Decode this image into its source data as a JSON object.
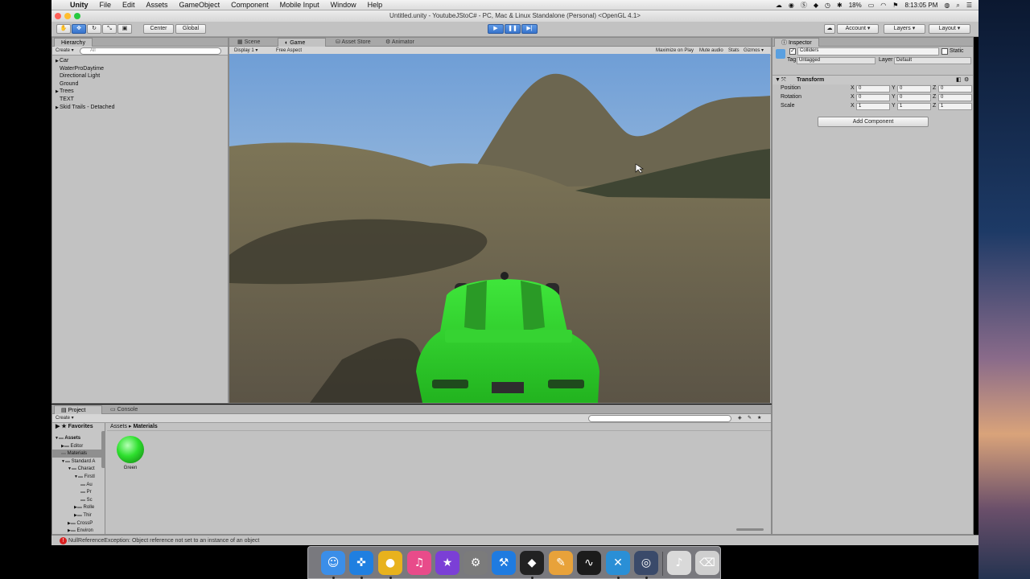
{
  "menubar": {
    "apple": "",
    "items": [
      "Unity",
      "File",
      "Edit",
      "Assets",
      "GameObject",
      "Component",
      "Mobile Input",
      "Window",
      "Help"
    ],
    "battery": "18%",
    "clock": "8:13:05 PM"
  },
  "window": {
    "title": "Untitled.unity - YoutubeJStoC# - PC, Mac & Linux Standalone (Personal) <OpenGL 4.1>"
  },
  "toolbar": {
    "center": "Center",
    "global": "Global",
    "account": "Account",
    "layers": "Layers",
    "layout": "Layout"
  },
  "hierarchy": {
    "tab": "Hierarchy",
    "create": "Create",
    "search_placeholder": "All",
    "items": [
      {
        "label": "Car",
        "expandable": true
      },
      {
        "label": "WaterProDaytime",
        "expandable": false
      },
      {
        "label": "Directional Light",
        "expandable": false
      },
      {
        "label": "Ground",
        "expandable": false
      },
      {
        "label": "Trees",
        "expandable": true
      },
      {
        "label": "TEXT",
        "expandable": false
      },
      {
        "label": "Skid Trails - Detached",
        "expandable": true
      }
    ]
  },
  "view_tabs": {
    "scene": "Scene",
    "game": "Game",
    "asset_store": "Asset Store",
    "animator": "Animator"
  },
  "game_bar": {
    "display": "Display 1",
    "aspect": "Free Aspect",
    "maximize": "Maximize on Play",
    "mute": "Mute audio",
    "stats": "Stats",
    "gizmos": "Gizmos"
  },
  "inspector": {
    "tab": "Inspector",
    "object_name": "Colliders",
    "static": "Static",
    "tag_label": "Tag",
    "tag_value": "Untagged",
    "layer_label": "Layer",
    "layer_value": "Default",
    "transform": "Transform",
    "rows": [
      {
        "label": "Position",
        "x": "0",
        "y": "0",
        "z": "0"
      },
      {
        "label": "Rotation",
        "x": "0",
        "y": "0",
        "z": "0"
      },
      {
        "label": "Scale",
        "x": "1",
        "y": "1",
        "z": "1"
      }
    ],
    "axis": [
      "X",
      "Y",
      "Z"
    ],
    "add_component": "Add Component"
  },
  "project": {
    "tab": "Project",
    "console_tab": "Console",
    "create": "Create",
    "favorites": "Favorites",
    "breadcrumb_root": "Assets",
    "breadcrumb_sep": "▸",
    "breadcrumb_leaf": "Materials",
    "tree": [
      {
        "label": "Assets",
        "level": 0,
        "bold": true,
        "arrow": "▼"
      },
      {
        "label": "Editor",
        "level": 1,
        "bold": false,
        "arrow": "▶"
      },
      {
        "label": "Materials",
        "level": 1,
        "bold": false,
        "arrow": "",
        "selected": true
      },
      {
        "label": "Standard A",
        "level": 1,
        "bold": false,
        "arrow": "▼"
      },
      {
        "label": "Charact",
        "level": 2,
        "bold": false,
        "arrow": "▼"
      },
      {
        "label": "FirstI",
        "level": 3,
        "bold": false,
        "arrow": "▼"
      },
      {
        "label": "Au",
        "level": 4,
        "bold": false,
        "arrow": ""
      },
      {
        "label": "Pr",
        "level": 4,
        "bold": false,
        "arrow": ""
      },
      {
        "label": "Sc",
        "level": 4,
        "bold": false,
        "arrow": ""
      },
      {
        "label": "Rolle",
        "level": 3,
        "bold": false,
        "arrow": "▶"
      },
      {
        "label": "Thir",
        "level": 3,
        "bold": false,
        "arrow": "▶"
      },
      {
        "label": "CrossP",
        "level": 2,
        "bold": false,
        "arrow": "▶"
      },
      {
        "label": "Environ",
        "level": 2,
        "bold": false,
        "arrow": "▶"
      }
    ],
    "asset": {
      "name": "Green",
      "color": "#2ee02e"
    }
  },
  "status": {
    "message": "NullReferenceException: Object reference not set to an instance of an object"
  },
  "dock": [
    {
      "name": "finder-icon",
      "glyph": "☺",
      "color": "#3b8ee8",
      "running": true
    },
    {
      "name": "safari-icon",
      "glyph": "✜",
      "color": "#1f7fe0",
      "running": true
    },
    {
      "name": "chrome-icon",
      "glyph": "●",
      "color": "#e8b21d",
      "running": true
    },
    {
      "name": "itunes-icon",
      "glyph": "♫",
      "color": "#e84b8a",
      "running": false
    },
    {
      "name": "imovie-icon",
      "glyph": "★",
      "color": "#7b3fd6",
      "running": false
    },
    {
      "name": "system-preferences-icon",
      "glyph": "⚙",
      "color": "#7b7b7b",
      "running": false
    },
    {
      "name": "xcode-icon",
      "glyph": "⚒",
      "color": "#1f7be0",
      "running": false
    },
    {
      "name": "unity-icon",
      "glyph": "◆",
      "color": "#222222",
      "running": true
    },
    {
      "name": "sketch-icon",
      "glyph": "✎",
      "color": "#e8a23a",
      "running": false
    },
    {
      "name": "activity-monitor-icon",
      "glyph": "∿",
      "color": "#1b1b1b",
      "running": false
    },
    {
      "name": "xamarin-icon",
      "glyph": "✕",
      "color": "#2a8fd6",
      "running": true
    },
    {
      "name": "quicktime-icon",
      "glyph": "◎",
      "color": "#3a4a6a",
      "running": true
    },
    {
      "name": "music-file-icon",
      "glyph": "♪",
      "color": "#d9d9d9",
      "running": false
    },
    {
      "name": "trash-icon",
      "glyph": "⌫",
      "color": "#cfcfcf",
      "running": false
    }
  ]
}
